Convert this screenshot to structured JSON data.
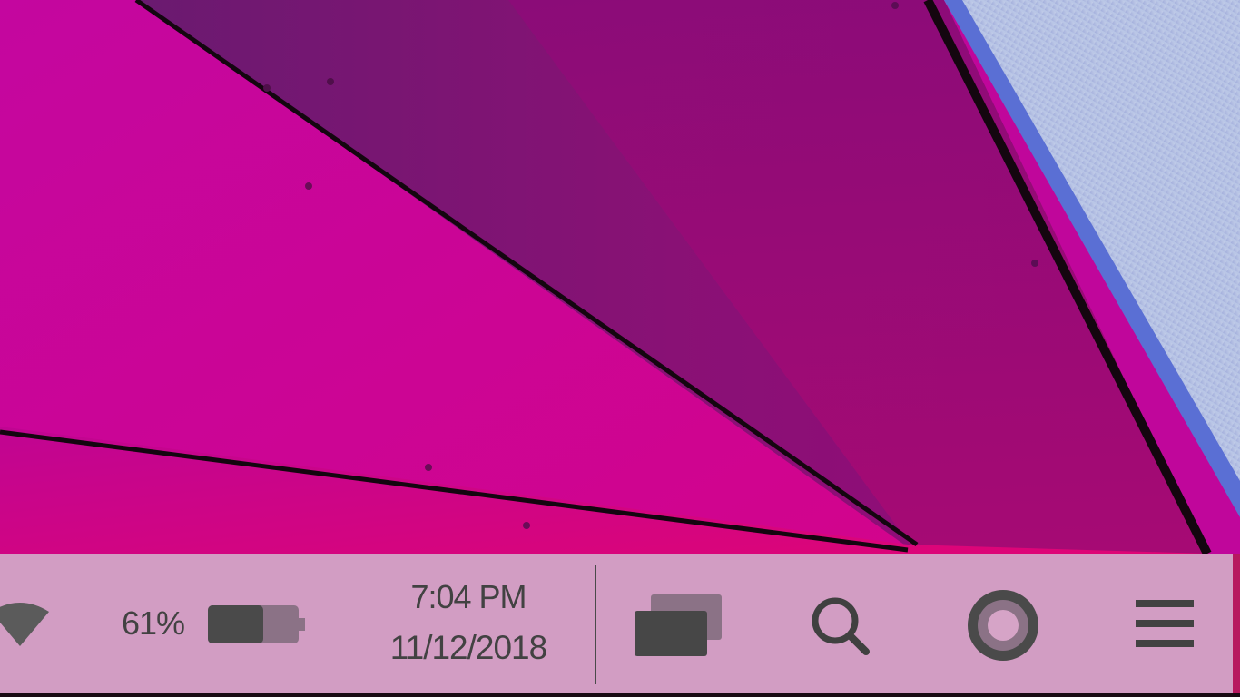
{
  "wallpaper": {
    "colors": {
      "left_panel": "#c7079a",
      "middle_panel": "#cc057f",
      "top_panel": "#7b1777",
      "right_panel": "#8f0a78",
      "bottom_strip": "#e0067a",
      "window_blue": "#5a78d6",
      "seam": "#14060f"
    }
  },
  "taskbar": {
    "background": "#d29dc3",
    "wifi": {
      "icon": "wifi-icon"
    },
    "battery": {
      "percent_label": "61%",
      "level": 0.61,
      "icon": "battery-icon"
    },
    "clock": {
      "time": "7:04 PM",
      "date": "11/12/2018"
    },
    "buttons": {
      "windows": {
        "icon": "windows-overview-icon"
      },
      "search": {
        "icon": "search-icon"
      },
      "assistant": {
        "icon": "ring-icon"
      },
      "menu": {
        "icon": "hamburger-menu-icon"
      }
    }
  }
}
